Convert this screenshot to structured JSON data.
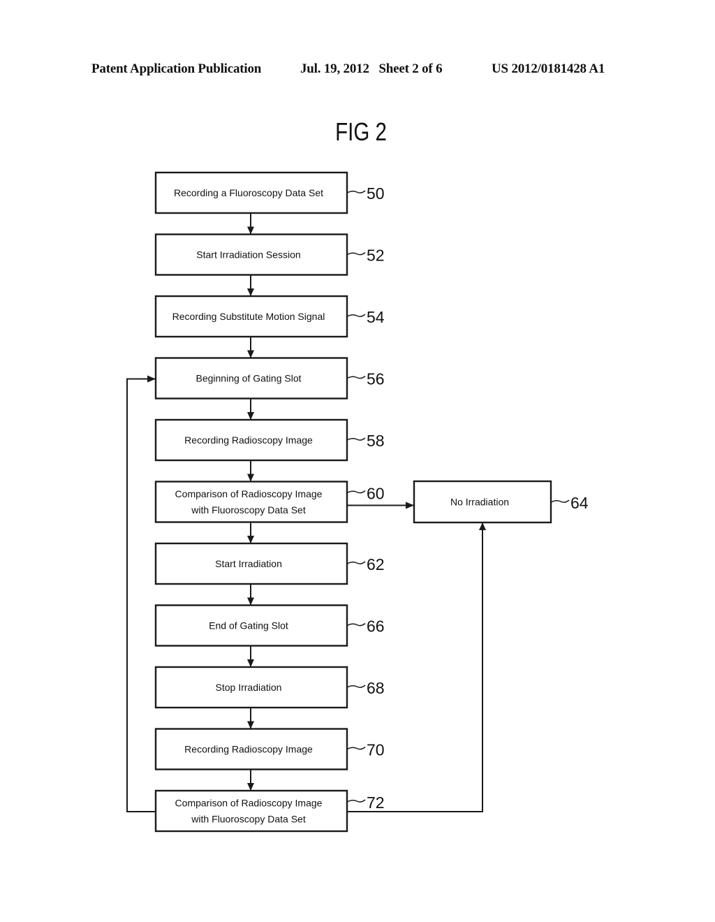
{
  "header": {
    "publication_type": "Patent Application Publication",
    "date_sheet": "Jul. 19, 2012   Sheet 2 of 6",
    "patent_number": "US 2012/0181428 A1"
  },
  "figure": {
    "title": "FIG 2"
  },
  "flowchart": {
    "steps": [
      {
        "id": "50",
        "lines": [
          "Recording a Fluoroscopy Data Set"
        ]
      },
      {
        "id": "52",
        "lines": [
          "Start Irradiation Session"
        ]
      },
      {
        "id": "54",
        "lines": [
          "Recording Substitute Motion Signal"
        ]
      },
      {
        "id": "56",
        "lines": [
          "Beginning of Gating Slot"
        ]
      },
      {
        "id": "58",
        "lines": [
          "Recording Radioscopy Image"
        ]
      },
      {
        "id": "60",
        "lines": [
          "Comparison of Radioscopy Image",
          "with Fluoroscopy Data Set"
        ]
      },
      {
        "id": "62",
        "lines": [
          "Start Irradiation"
        ]
      },
      {
        "id": "66",
        "lines": [
          "End of Gating Slot"
        ]
      },
      {
        "id": "68",
        "lines": [
          "Stop Irradiation"
        ]
      },
      {
        "id": "70",
        "lines": [
          "Recording Radioscopy Image"
        ]
      },
      {
        "id": "72",
        "lines": [
          "Comparison of Radioscopy Image",
          "with Fluoroscopy Data Set"
        ]
      }
    ],
    "side_step": {
      "id": "64",
      "lines": [
        "No Irradiation"
      ]
    },
    "connections": [
      {
        "from": "50",
        "to": "52"
      },
      {
        "from": "52",
        "to": "54"
      },
      {
        "from": "54",
        "to": "56"
      },
      {
        "from": "56",
        "to": "58"
      },
      {
        "from": "58",
        "to": "60"
      },
      {
        "from": "60",
        "to": "62"
      },
      {
        "from": "60",
        "to": "64"
      },
      {
        "from": "62",
        "to": "66"
      },
      {
        "from": "66",
        "to": "68"
      },
      {
        "from": "68",
        "to": "70"
      },
      {
        "from": "70",
        "to": "72"
      },
      {
        "from": "72",
        "to": "56"
      },
      {
        "from": "72",
        "to": "64"
      }
    ]
  }
}
